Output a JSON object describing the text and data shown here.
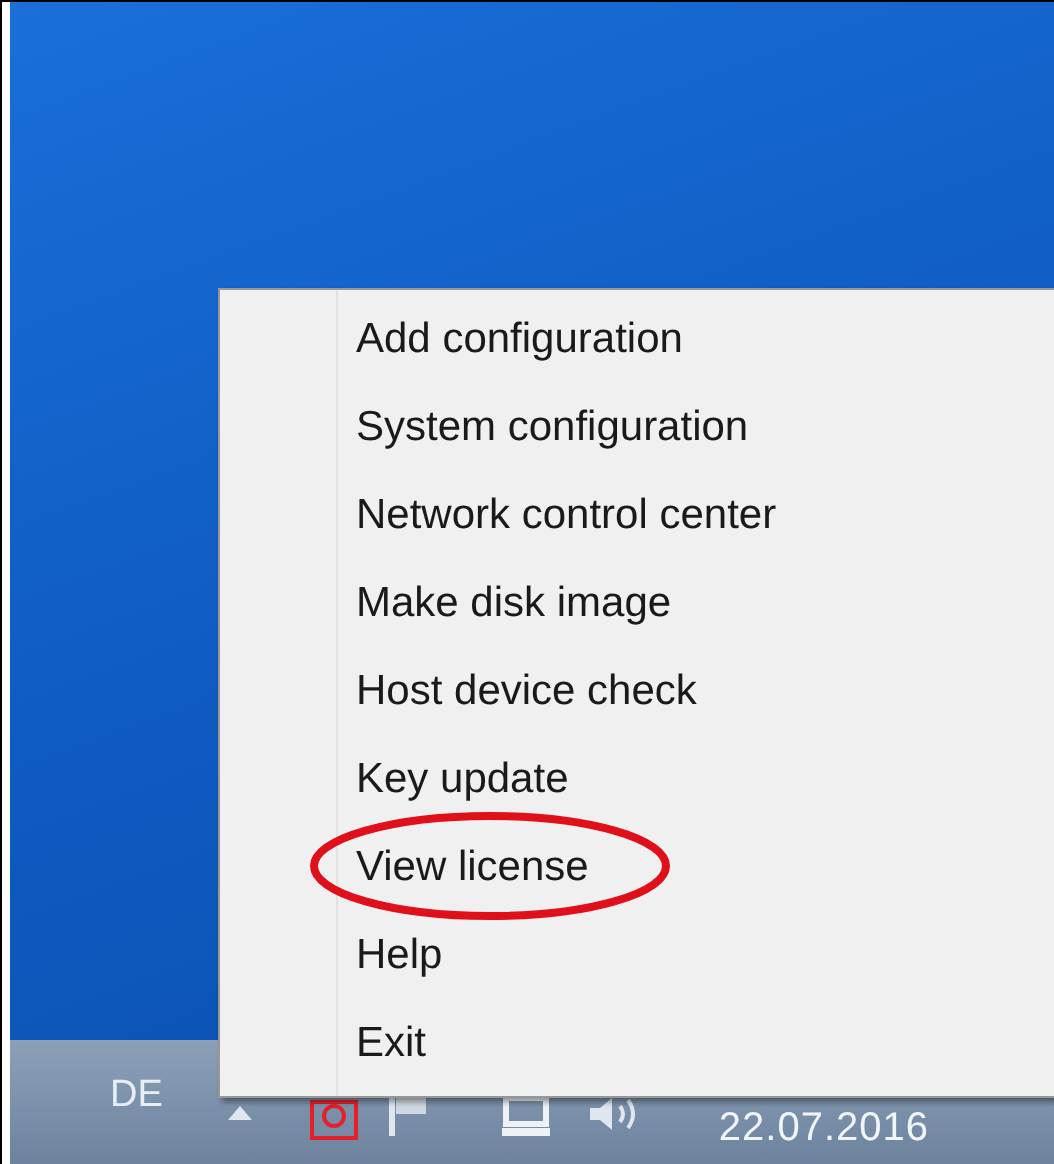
{
  "context_menu": {
    "items": [
      {
        "label": "Add configuration",
        "circled": false
      },
      {
        "label": "System configuration",
        "circled": false
      },
      {
        "label": "Network control center",
        "circled": false
      },
      {
        "label": "Make disk image",
        "circled": false
      },
      {
        "label": "Host device check",
        "circled": false
      },
      {
        "label": "Key update",
        "circled": false
      },
      {
        "label": "View license",
        "circled": true
      },
      {
        "label": "Help",
        "circled": false
      },
      {
        "label": "Exit",
        "circled": false
      }
    ]
  },
  "taskbar": {
    "language": "DE",
    "date": "22.07.2016"
  }
}
